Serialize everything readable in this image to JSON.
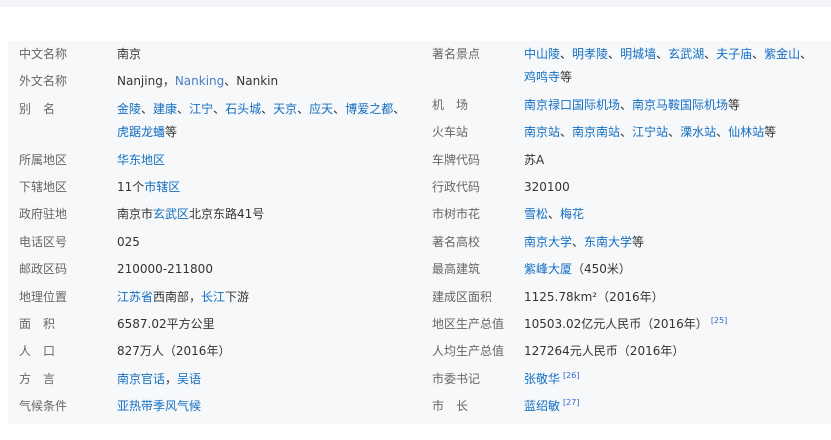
{
  "left": [
    {
      "key": "中文名称",
      "parts": [
        {
          "t": "南京"
        }
      ]
    },
    {
      "key": "外文名称",
      "parts": [
        {
          "t": "Nanjing，"
        },
        {
          "t": "Nanking",
          "link": true,
          "vis": true
        },
        {
          "t": "、Nankin"
        }
      ]
    },
    {
      "key": "别　名",
      "parts": [
        {
          "t": "金陵",
          "link": true
        },
        {
          "t": "、"
        },
        {
          "t": "建康",
          "link": true
        },
        {
          "t": "、"
        },
        {
          "t": "江宁",
          "link": true
        },
        {
          "t": "、"
        },
        {
          "t": "石头城",
          "link": true
        },
        {
          "t": "、"
        },
        {
          "t": "天京",
          "link": true
        },
        {
          "t": "、"
        },
        {
          "t": "应天",
          "link": true
        },
        {
          "t": "、"
        },
        {
          "t": "博爱之都",
          "link": true
        },
        {
          "t": "、"
        },
        {
          "t": "虎踞龙蟠",
          "link": true
        },
        {
          "t": "等"
        }
      ]
    },
    {
      "key": "所属地区",
      "parts": [
        {
          "t": "华东地区",
          "link": true
        }
      ]
    },
    {
      "key": "下辖地区",
      "parts": [
        {
          "t": "11个"
        },
        {
          "t": "市辖区",
          "link": true
        }
      ]
    },
    {
      "key": "政府驻地",
      "parts": [
        {
          "t": "南京市"
        },
        {
          "t": "玄武区",
          "link": true
        },
        {
          "t": "北京东路41号"
        }
      ]
    },
    {
      "key": "电话区号",
      "parts": [
        {
          "t": "025"
        }
      ]
    },
    {
      "key": "邮政区码",
      "parts": [
        {
          "t": "210000-211800"
        }
      ]
    },
    {
      "key": "地理位置",
      "parts": [
        {
          "t": "江苏省",
          "link": true
        },
        {
          "t": "西南部，"
        },
        {
          "t": "长江",
          "link": true
        },
        {
          "t": "下游"
        }
      ]
    },
    {
      "key": "面　积",
      "parts": [
        {
          "t": "6587.02平方公里"
        }
      ]
    },
    {
      "key": "人　口",
      "parts": [
        {
          "t": "827万人（2016年）"
        }
      ]
    },
    {
      "key": "方　言",
      "parts": [
        {
          "t": "南京官话",
          "link": true
        },
        {
          "t": "，"
        },
        {
          "t": "吴语",
          "link": true
        }
      ]
    },
    {
      "key": "气候条件",
      "parts": [
        {
          "t": "亚热带季风气候",
          "link": true
        }
      ]
    }
  ],
  "right": [
    {
      "key": "著名景点",
      "parts": [
        {
          "t": "中山陵",
          "link": true
        },
        {
          "t": "、"
        },
        {
          "t": "明孝陵",
          "link": true
        },
        {
          "t": "、"
        },
        {
          "t": "明城墙",
          "link": true
        },
        {
          "t": "、"
        },
        {
          "t": "玄武湖",
          "link": true
        },
        {
          "t": "、"
        },
        {
          "t": "夫子庙",
          "link": true
        },
        {
          "t": "、"
        },
        {
          "t": "紫金山",
          "link": true
        },
        {
          "t": "、"
        },
        {
          "t": "鸡鸣寺",
          "link": true
        },
        {
          "t": "等"
        }
      ]
    },
    {
      "key": "机　场",
      "parts": [
        {
          "t": "南京禄口国际机场",
          "link": true
        },
        {
          "t": "、"
        },
        {
          "t": "南京马鞍国际机场",
          "link": true
        },
        {
          "t": "等"
        }
      ]
    },
    {
      "key": "火车站",
      "parts": [
        {
          "t": "南京站",
          "link": true
        },
        {
          "t": "、"
        },
        {
          "t": "南京南站",
          "link": true
        },
        {
          "t": "、"
        },
        {
          "t": "江宁站",
          "link": true
        },
        {
          "t": "、"
        },
        {
          "t": "溧水站",
          "link": true
        },
        {
          "t": "、"
        },
        {
          "t": "仙林站",
          "link": true
        },
        {
          "t": "等"
        }
      ]
    },
    {
      "key": "车牌代码",
      "parts": [
        {
          "t": "苏A"
        }
      ]
    },
    {
      "key": "行政代码",
      "parts": [
        {
          "t": "320100"
        }
      ]
    },
    {
      "key": "市树市花",
      "parts": [
        {
          "t": "雪松",
          "link": true
        },
        {
          "t": "、"
        },
        {
          "t": "梅花",
          "link": true
        }
      ]
    },
    {
      "key": "著名高校",
      "parts": [
        {
          "t": "南京大学",
          "link": true
        },
        {
          "t": "、"
        },
        {
          "t": "东南大学",
          "link": true
        },
        {
          "t": "等"
        }
      ]
    },
    {
      "key": "最高建筑",
      "parts": [
        {
          "t": "紫峰大厦",
          "link": true
        },
        {
          "t": "（450米）"
        }
      ]
    },
    {
      "key": "建成区面积",
      "parts": [
        {
          "t": "1125.78km²（2016年）"
        }
      ]
    },
    {
      "key": "地区生产总值",
      "parts": [
        {
          "t": "10503.02亿元人民币（2016年）"
        },
        {
          "t": "[25]",
          "ref": true
        }
      ]
    },
    {
      "key": "人均生产总值",
      "parts": [
        {
          "t": "127264元人民币（2016年）"
        }
      ]
    },
    {
      "key": "市委书记",
      "parts": [
        {
          "t": "张敬华",
          "link": true
        },
        {
          "t": "[26]",
          "ref": true
        }
      ]
    },
    {
      "key": "市　长",
      "parts": [
        {
          "t": "蓝绍敏",
          "link": true
        },
        {
          "t": "[27]",
          "ref": true
        }
      ]
    }
  ]
}
